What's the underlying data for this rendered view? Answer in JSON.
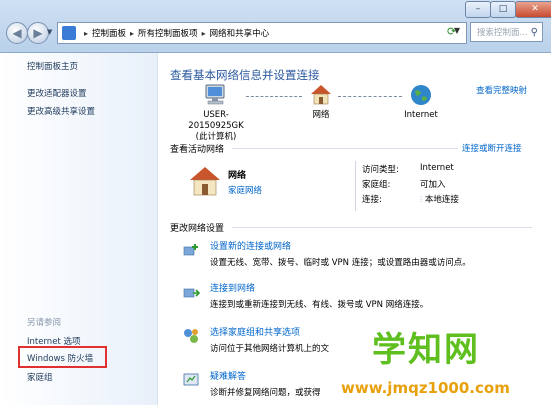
{
  "breadcrumb": [
    "控制面板",
    "所有控制面板项",
    "网络和共享中心"
  ],
  "search_placeholder": "搜索控制面...",
  "sidebar": {
    "home": "控制面板主页",
    "items": [
      "更改适配器设置",
      "更改高级共享设置"
    ],
    "see_also_title": "另请参阅",
    "see_also": [
      "Internet 选项",
      "Windows 防火墙",
      "家庭组"
    ]
  },
  "main": {
    "title": "查看基本网络信息并设置连接",
    "full_map": "查看完整映射",
    "nodes": [
      {
        "label": "USER-20150925GK",
        "sub": "(此计算机)"
      },
      {
        "label": "网络",
        "sub": ""
      },
      {
        "label": "Internet",
        "sub": ""
      }
    ],
    "active_title": "查看活动网络",
    "connect_disconnect": "连接或断开连接",
    "network_name": "网络",
    "network_type": "家庭网络",
    "access_type_label": "访问类型:",
    "access_type_value": "Internet",
    "homegroup_label": "家庭组:",
    "homegroup_value": "可加入",
    "connection_label": "连接:",
    "connection_value": "本地连接",
    "change_title": "更改网络设置",
    "tasks": [
      {
        "link": "设置新的连接或网络",
        "desc": "设置无线、宽带、拨号、临时或 VPN 连接；或设置路由器或访问点。"
      },
      {
        "link": "连接到网络",
        "desc": "连接到或重新连接到无线、有线、拨号或 VPN 网络连接。"
      },
      {
        "link": "选择家庭组和共享选项",
        "desc": "访问位于其他网络计算机上的文"
      },
      {
        "link": "疑难解答",
        "desc": "诊断并修复网络问题，或获得"
      }
    ]
  },
  "watermark": {
    "name": "学知网",
    "url": "www.jmqz1000.com"
  },
  "colors": {
    "accent": "#2c5aa0",
    "link": "#0066cc",
    "highlight": "#e03030",
    "watermark_green": "#5fbf1f",
    "watermark_orange": "#e8a10c"
  }
}
